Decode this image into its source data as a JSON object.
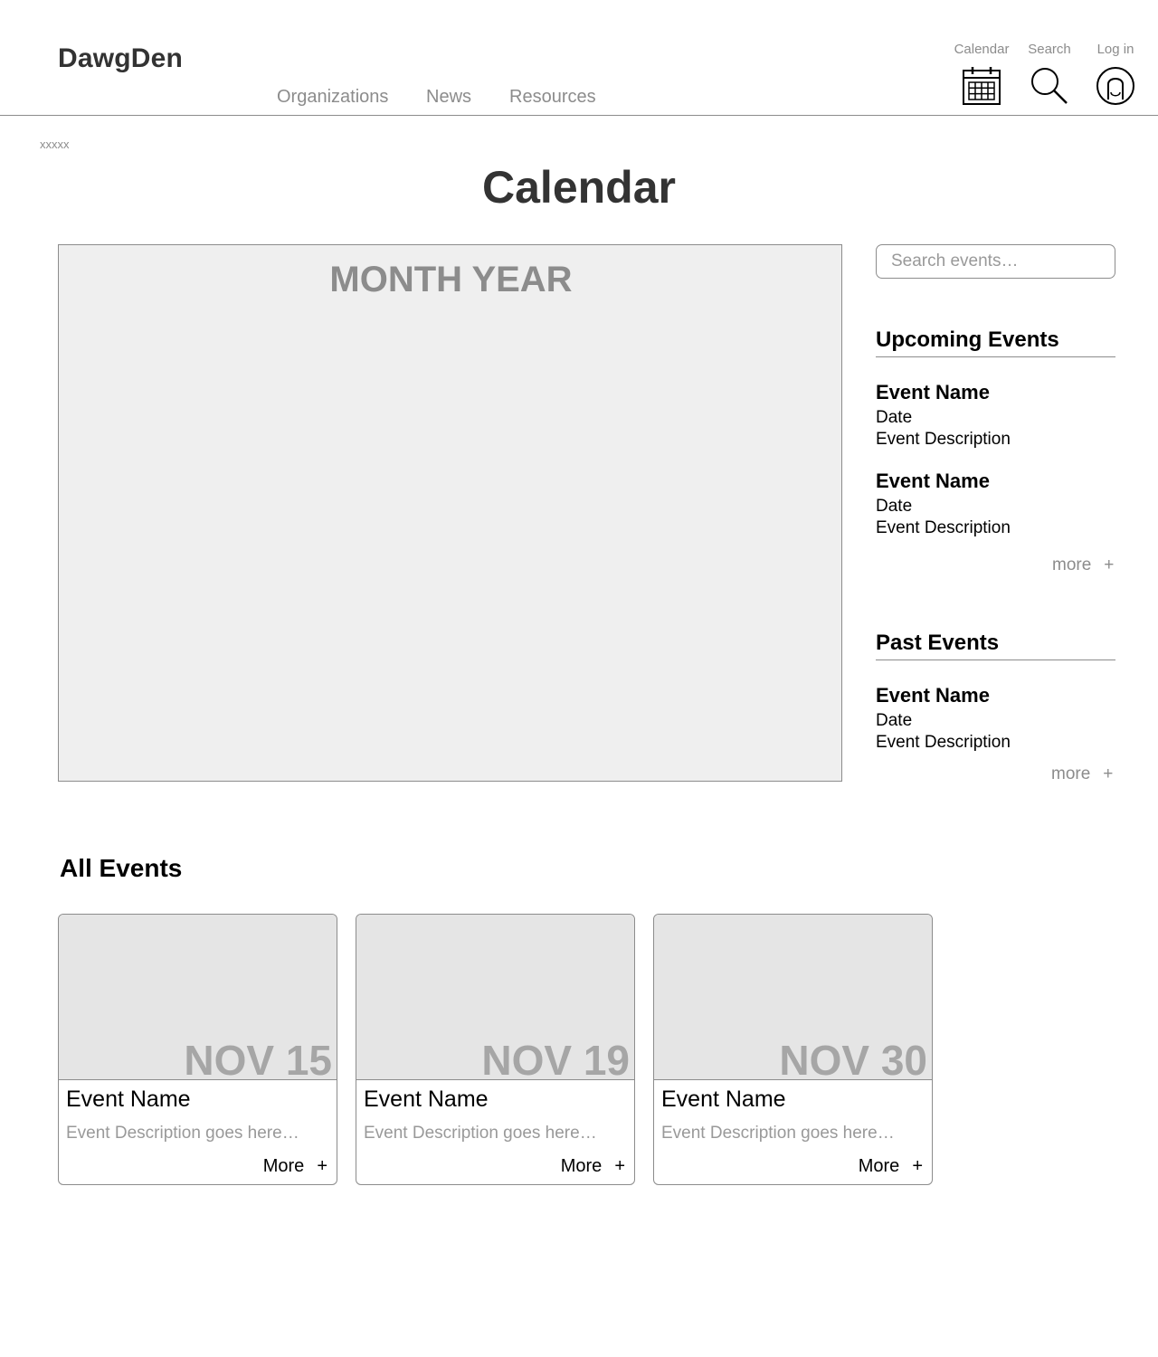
{
  "header": {
    "logo": "DawgDen",
    "nav": [
      "Organizations",
      "News",
      "Resources"
    ],
    "utility": {
      "calendar_label": "Calendar",
      "search_label": "Search",
      "login_label": "Log in"
    }
  },
  "breadcrumb": "xxxxx",
  "page_title": "Calendar",
  "calendar": {
    "month_year": "MONTH YEAR"
  },
  "search": {
    "placeholder": "Search events…"
  },
  "upcoming": {
    "heading": "Upcoming Events",
    "events": [
      {
        "name": "Event Name",
        "date": "Date",
        "description": "Event Description"
      },
      {
        "name": "Event Name",
        "date": "Date",
        "description": "Event Description"
      }
    ],
    "more_label": "more",
    "more_icon": "+"
  },
  "past": {
    "heading": "Past Events",
    "events": [
      {
        "name": "Event Name",
        "date": "Date",
        "description": "Event Description"
      }
    ],
    "more_label": "more",
    "more_icon": "+"
  },
  "all_events": {
    "heading": "All Events",
    "cards": [
      {
        "date": "NOV 15",
        "name": "Event Name",
        "description": "Event Description goes here…",
        "more_label": "More",
        "more_icon": "+"
      },
      {
        "date": "NOV 19",
        "name": "Event Name",
        "description": "Event Description goes here…",
        "more_label": "More",
        "more_icon": "+"
      },
      {
        "date": "NOV 30",
        "name": "Event Name",
        "description": "Event Description goes here…",
        "more_label": "More",
        "more_icon": "+"
      }
    ]
  },
  "icons": {
    "calendar": "calendar-icon",
    "search": "magnifier-icon",
    "login": "user-circle-icon"
  },
  "colors": {
    "muted_gray": "#8c8c8c",
    "panel_gray": "#efefef",
    "card_image_gray": "#e5e5e5",
    "date_gray": "#a6a6a6"
  }
}
